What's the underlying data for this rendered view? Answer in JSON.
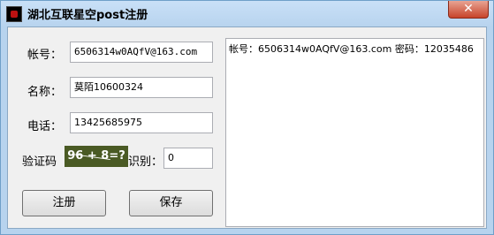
{
  "window": {
    "title": "湖北互联星空post注册",
    "close_glyph": "✕"
  },
  "form": {
    "account_label": "帐号：",
    "account_value": "6506314w0AQfV@163.com",
    "name_label": "名称：",
    "name_value": "莫陌10600324",
    "phone_label": "电话：",
    "phone_value": "13425685975",
    "captcha_label": "验证码",
    "captcha_text": "96 + 8=?",
    "recognize_label": "识别：",
    "recognize_value": "0"
  },
  "buttons": {
    "register": "注册",
    "save": "保存"
  },
  "log": {
    "text": "帐号：6506314w0AQfV@163.com 密码：12035486"
  }
}
